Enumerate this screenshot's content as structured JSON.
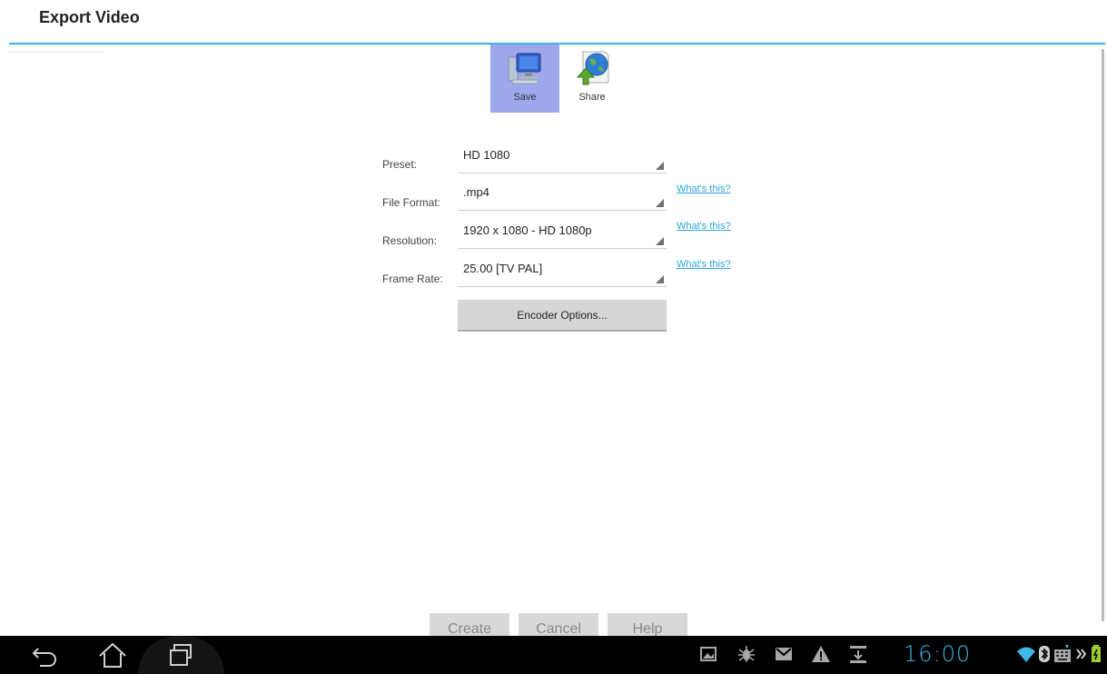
{
  "window": {
    "title": "Export Video"
  },
  "modes": [
    {
      "label": "Save",
      "icon": "computer-icon",
      "selected": true
    },
    {
      "label": "Share",
      "icon": "globe-share-icon",
      "selected": false
    }
  ],
  "form": {
    "preset": {
      "label": "Preset:",
      "value": "HD 1080"
    },
    "file_format": {
      "label": "File Format:",
      "value": ".mp4",
      "help": "What's this?"
    },
    "resolution": {
      "label": "Resolution:",
      "value": "1920 x 1080 - HD 1080p",
      "help": "What's this?"
    },
    "frame_rate": {
      "label": "Frame Rate:",
      "value": "25.00 [TV PAL]",
      "help": "What's this?"
    },
    "encoder_options": "Encoder Options..."
  },
  "actions": {
    "create": "Create",
    "cancel": "Cancel",
    "help": "Help"
  },
  "system_bar": {
    "time": "16:00",
    "nav_icons": [
      "back-icon",
      "home-icon",
      "recent-apps-icon"
    ],
    "status_icons": [
      "gallery-icon",
      "bug-icon",
      "gmail-icon",
      "warning-icon",
      "download-icon",
      "wifi-icon",
      "bluetooth-icon",
      "keyboard-icon",
      "more-icon",
      "battery-icon"
    ],
    "accent_color": "#3fb6e8"
  },
  "colors": {
    "accent": "#33b5e5",
    "selected_tab": "#9ea7ec",
    "link": "#2ca4d8"
  }
}
